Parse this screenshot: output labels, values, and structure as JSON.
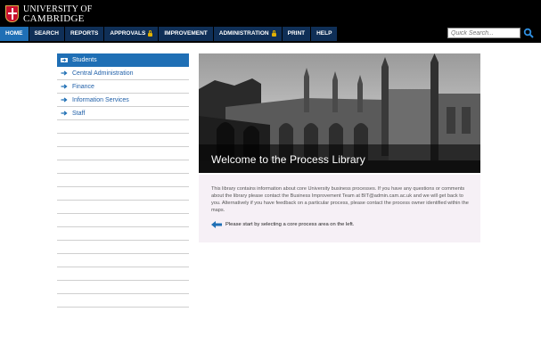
{
  "header": {
    "logo_line1": "UNIVERSITY OF",
    "logo_line2": "CAMBRIDGE",
    "nav": [
      {
        "label": "HOME",
        "active": true,
        "locked": false
      },
      {
        "label": "SEARCH",
        "active": false,
        "locked": false
      },
      {
        "label": "REPORTS",
        "active": false,
        "locked": false
      },
      {
        "label": "APPROVALS",
        "active": false,
        "locked": true
      },
      {
        "label": "IMPROVEMENT",
        "active": false,
        "locked": false
      },
      {
        "label": "ADMINISTRATION",
        "active": false,
        "locked": true
      },
      {
        "label": "PRINT",
        "active": false,
        "locked": false
      },
      {
        "label": "HELP",
        "active": false,
        "locked": false
      }
    ],
    "search_placeholder": "Quick Search..."
  },
  "sidebar": {
    "items": [
      {
        "label": "Students",
        "active": true
      },
      {
        "label": "Central Administration",
        "active": false
      },
      {
        "label": "Finance",
        "active": false
      },
      {
        "label": "Information Services",
        "active": false
      },
      {
        "label": "Staff",
        "active": false
      }
    ]
  },
  "main": {
    "hero_title": "Welcome to the Process Library",
    "intro": "This library contains information about core University business processes. If you have any questions or comments about the library please contact the Business Improvement Team at BIT@admin.cam.ac.uk and we will get back to you. Alternatively if you have feedback on a particular process, please contact the process owner identified within the maps.",
    "hint": "Please start by selecting a core process area on the left."
  },
  "colors": {
    "nav_bg": "#0f2f57",
    "nav_active": "#1f6fb5",
    "link": "#1f5fa8",
    "panel_bg": "#f6f0f6"
  }
}
